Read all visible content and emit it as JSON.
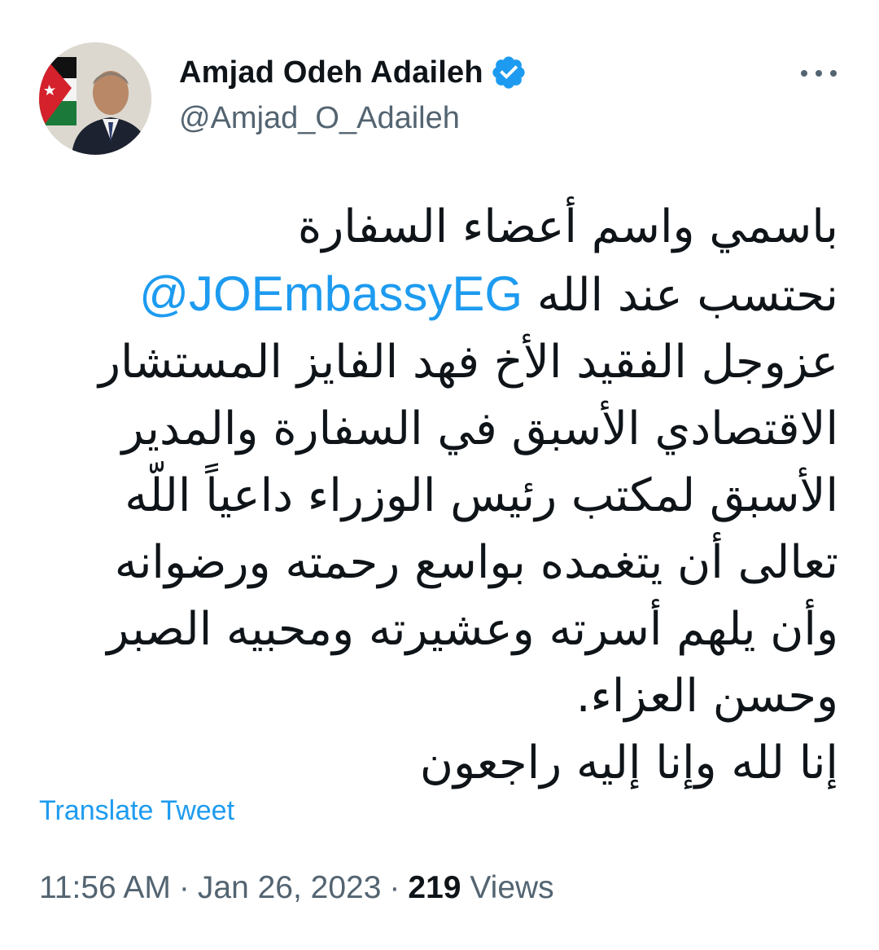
{
  "author": {
    "display_name": "Amjad Odeh Adaileh",
    "handle": "@Amjad_O_Adaileh",
    "verified": true,
    "avatar_icon": "profile-photo"
  },
  "tweet": {
    "lines": [
      {
        "text": "باسمي واسم أعضاء السفارة"
      },
      {
        "mention": "@JOEmbassyEG",
        "text": "نحتسب عند الله"
      },
      {
        "text": "عزوجل الفقيد الأخ فهد الفايز المستشار"
      },
      {
        "text": "الاقتصادي الأسبق في السفارة والمدير"
      },
      {
        "text": "الأسبق لمكتب رئيس الوزراء داعياً اللّه"
      },
      {
        "text": "تعالى أن يتغمده بواسع رحمته ورضوانه"
      },
      {
        "text": "وأن يلهم أسرته وعشيرته ومحبيه الصبر"
      },
      {
        "text": "وحسن العزاء."
      },
      {
        "text": "إنا لله وإنا إليه راجعون"
      }
    ]
  },
  "actions": {
    "translate_label": "Translate Tweet",
    "more_icon": "more-dots"
  },
  "meta": {
    "time": "11:56 AM",
    "separator": "·",
    "date": "Jan 26, 2023",
    "views_count": "219",
    "views_label": "Views"
  },
  "colors": {
    "accent": "#1d9bf0",
    "text_primary": "#0f1419",
    "text_secondary": "#536471",
    "background": "#ffffff"
  }
}
